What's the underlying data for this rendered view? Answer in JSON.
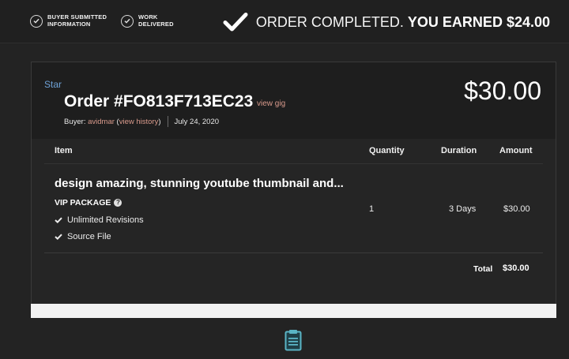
{
  "topbar": {
    "steps": [
      {
        "label_line1": "BUYER SUBMITTED",
        "label_line2": "INFORMATION",
        "icon": "check-circle-icon"
      },
      {
        "label_line1": "WORK",
        "label_line2": "DELIVERED",
        "icon": "check-circle-icon"
      }
    ],
    "status_text": "ORDER COMPLETED.",
    "earned_text": "YOU EARNED $24.00"
  },
  "order": {
    "star_label": "Star",
    "title": "Order #FO813F713EC23",
    "view_gig_label": "view gig",
    "buyer_prefix": "Buyer:",
    "buyer_name": "avidmar",
    "view_history_label": "view history",
    "date": "July 24, 2020",
    "price": "$30.00"
  },
  "table": {
    "headers": {
      "item": "Item",
      "quantity": "Quantity",
      "duration": "Duration",
      "amount": "Amount"
    },
    "row": {
      "title": "design amazing, stunning youtube thumbnail and...",
      "package": "VIP PACKAGE",
      "features": [
        "Unlimited Revisions",
        "Source File"
      ],
      "quantity": "1",
      "duration": "3 Days",
      "amount": "$30.00"
    },
    "total_label": "Total",
    "total_value": "$30.00"
  },
  "colors": {
    "background": "#232323",
    "link": "#d99a8c",
    "star": "#6ea1d6",
    "clipboard": "#5ab4c5"
  }
}
